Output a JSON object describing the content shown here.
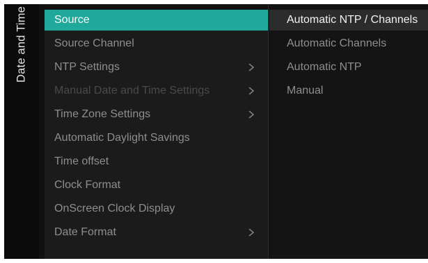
{
  "sidebar": {
    "title": "Date and Time"
  },
  "menu": {
    "items": [
      {
        "label": "Source",
        "has_submenu": false,
        "selected": true,
        "disabled": false
      },
      {
        "label": "Source Channel",
        "has_submenu": false,
        "selected": false,
        "disabled": false
      },
      {
        "label": "NTP Settings",
        "has_submenu": true,
        "selected": false,
        "disabled": false
      },
      {
        "label": "Manual Date and Time Settings",
        "has_submenu": true,
        "selected": false,
        "disabled": true
      },
      {
        "label": "Time Zone Settings",
        "has_submenu": true,
        "selected": false,
        "disabled": false
      },
      {
        "label": "Automatic Daylight Savings",
        "has_submenu": false,
        "selected": false,
        "disabled": false
      },
      {
        "label": "Time offset",
        "has_submenu": false,
        "selected": false,
        "disabled": false
      },
      {
        "label": "Clock Format",
        "has_submenu": false,
        "selected": false,
        "disabled": false
      },
      {
        "label": "OnScreen Clock Display",
        "has_submenu": false,
        "selected": false,
        "disabled": false
      },
      {
        "label": "Date Format",
        "has_submenu": true,
        "selected": false,
        "disabled": false
      }
    ]
  },
  "options": {
    "items": [
      {
        "label": "Automatic NTP / Channels",
        "selected": true
      },
      {
        "label": "Automatic Channels",
        "selected": false
      },
      {
        "label": "Automatic NTP",
        "selected": false
      },
      {
        "label": "Manual",
        "selected": false
      }
    ]
  },
  "colors": {
    "accent": "#1fa99b",
    "background": "#111111",
    "text_primary": "#ffffff",
    "text_secondary": "#8e8e8e",
    "text_disabled": "#4a4a4a",
    "option_highlight": "#2c2c2c"
  },
  "icons": {
    "submenu_indicator": "chevron-right-icon"
  }
}
